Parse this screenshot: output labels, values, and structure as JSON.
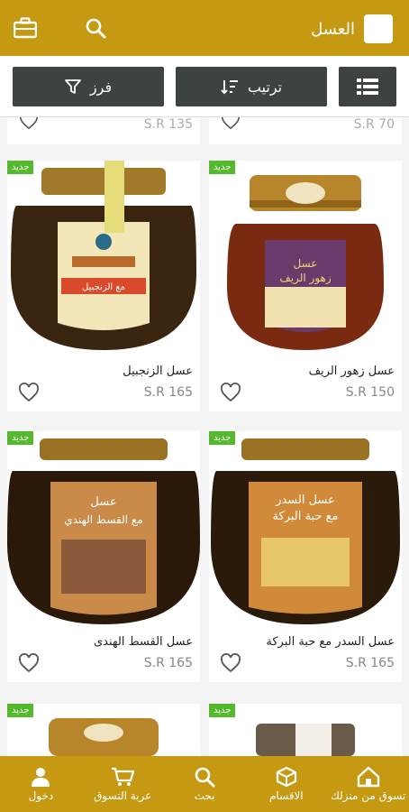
{
  "header": {
    "title": "العسل"
  },
  "filters": {
    "filter_label": "فرز",
    "sort_label": "ترتيب"
  },
  "partial_top": [
    {
      "price": "S.R 70"
    },
    {
      "price": "S.R 135"
    }
  ],
  "products": [
    {
      "badge": "جديد",
      "name": "عسل زهور الريف",
      "price": "S.R 150",
      "jar_label": "عسل\nزهور الريف",
      "lid": "#b8862a",
      "body": "#7a2a10",
      "label_bg": "#6a3a6a"
    },
    {
      "badge": "جديد",
      "name": "عسل الزنجبيل",
      "price": "S.R 165",
      "jar_label": "مع الزنجبيل",
      "lid": "#a07a2a",
      "body": "#3a2510",
      "label_bg": "#f3e6b8"
    },
    {
      "badge": "جديد",
      "name": "عسل السدر مع حبة البركة",
      "price": "S.R 165",
      "jar_label": "عسل السدر\nمع حبة البركة",
      "lid": "#9a7224",
      "body": "#2a1a0a",
      "label_bg": "#d08a3a"
    },
    {
      "badge": "جديد",
      "name": "عسل القسط الهندى",
      "price": "S.R 165",
      "jar_label": "عسل\nمع القسط الهندي",
      "lid": "#9a7224",
      "body": "#2a1808",
      "label_bg": "#c98a4a"
    }
  ],
  "partial_bottom": [
    {
      "badge": "جديد"
    },
    {
      "badge": "جديد"
    }
  ],
  "bottom_nav": [
    {
      "label": "تسوق من منزلك",
      "icon": "home-icon"
    },
    {
      "label": "الاقسام",
      "icon": "box-icon"
    },
    {
      "label": "بحث",
      "icon": "search-icon"
    },
    {
      "label": "عربة التسوق",
      "icon": "cart-icon"
    },
    {
      "label": "دخول",
      "icon": "user-icon"
    }
  ]
}
